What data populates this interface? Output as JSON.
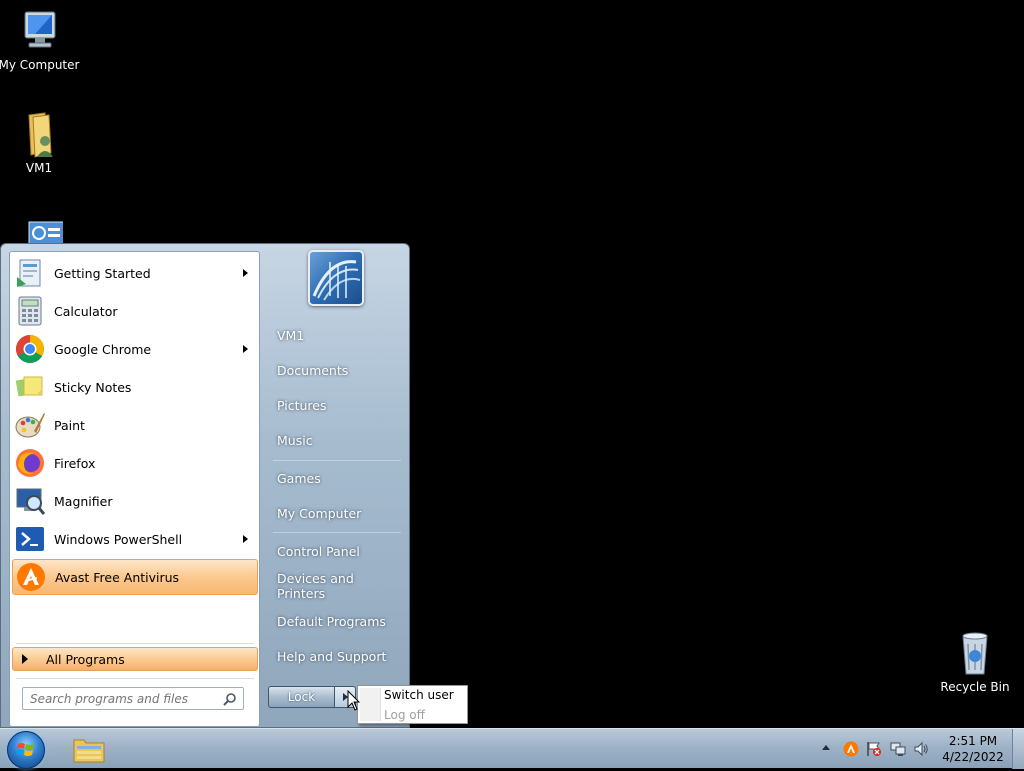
{
  "desktop": {
    "icons": [
      {
        "label": "My Computer",
        "icon": "computer-icon"
      },
      {
        "label": "VM1",
        "icon": "user-folder-icon"
      },
      {
        "label": "Recycle Bin",
        "icon": "recycle-bin-icon"
      }
    ]
  },
  "start_menu": {
    "programs": [
      {
        "label": "Getting Started",
        "icon": "getting-started-icon",
        "has_submenu": true
      },
      {
        "label": "Calculator",
        "icon": "calculator-icon",
        "has_submenu": false
      },
      {
        "label": "Google Chrome",
        "icon": "chrome-icon",
        "has_submenu": true
      },
      {
        "label": "Sticky Notes",
        "icon": "sticky-notes-icon",
        "has_submenu": false
      },
      {
        "label": "Paint",
        "icon": "paint-icon",
        "has_submenu": false
      },
      {
        "label": "Firefox",
        "icon": "firefox-icon",
        "has_submenu": false
      },
      {
        "label": "Magnifier",
        "icon": "magnifier-icon",
        "has_submenu": false
      },
      {
        "label": "Windows PowerShell",
        "icon": "powershell-icon",
        "has_submenu": true
      },
      {
        "label": "Avast Free Antivirus",
        "icon": "avast-icon",
        "has_submenu": false,
        "highlighted": true
      }
    ],
    "all_programs_label": "All Programs",
    "search_placeholder": "Search programs and files",
    "right_items": [
      {
        "label": "VM1"
      },
      {
        "label": "Documents"
      },
      {
        "label": "Pictures"
      },
      {
        "label": "Music"
      },
      {
        "label": "Games"
      },
      {
        "label": "My Computer"
      },
      {
        "label": "Control Panel"
      },
      {
        "label": "Devices and Printers"
      },
      {
        "label": "Default Programs"
      },
      {
        "label": "Help and Support"
      }
    ],
    "lock_label": "Lock",
    "power_menu": {
      "items": [
        {
          "label": "Switch user",
          "enabled": true
        },
        {
          "label": "Log off",
          "enabled": false
        }
      ]
    }
  },
  "taskbar": {
    "clock_time": "2:51 PM",
    "clock_date": "4/22/2022"
  },
  "colors": {
    "desktop_background": "#000000",
    "highlight_orange": "#fbc98f",
    "taskbar_blue": "#9fb3c7"
  }
}
